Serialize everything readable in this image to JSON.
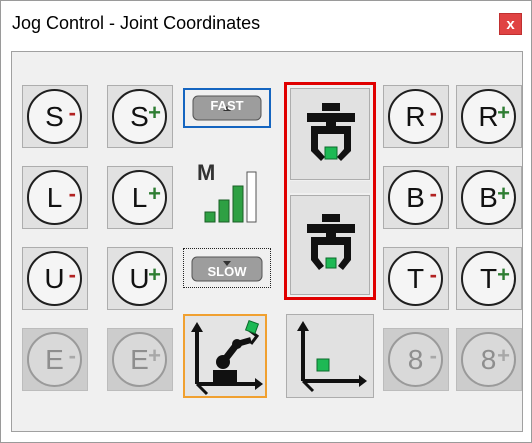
{
  "window": {
    "title": "Jog Control - Joint Coordinates",
    "close_label": "x"
  },
  "joints": {
    "s_minus": {
      "letter": "S",
      "sign": "-"
    },
    "s_plus": {
      "letter": "S",
      "sign": "+"
    },
    "l_minus": {
      "letter": "L",
      "sign": "-"
    },
    "l_plus": {
      "letter": "L",
      "sign": "+"
    },
    "u_minus": {
      "letter": "U",
      "sign": "-"
    },
    "u_plus": {
      "letter": "U",
      "sign": "+"
    },
    "e_minus": {
      "letter": "E",
      "sign": "-"
    },
    "e_plus": {
      "letter": "E",
      "sign": "+"
    },
    "r_minus": {
      "letter": "R",
      "sign": "-"
    },
    "r_plus": {
      "letter": "R",
      "sign": "+"
    },
    "b_minus": {
      "letter": "B",
      "sign": "-"
    },
    "b_plus": {
      "letter": "B",
      "sign": "+"
    },
    "t_minus": {
      "letter": "T",
      "sign": "-"
    },
    "t_plus": {
      "letter": "T",
      "sign": "+"
    },
    "axis8_minus": {
      "letter": "8",
      "sign": "-"
    },
    "axis8_plus": {
      "letter": "8",
      "sign": "+"
    }
  },
  "speed": {
    "fast_label": "FAST",
    "slow_label": "SLOW",
    "level_label": "M",
    "level_bars_filled": 3,
    "level_bars_total": 4
  },
  "colors": {
    "minus_sign": "#b22222",
    "plus_sign": "#2e7d32",
    "selected_speed": "#1565c0",
    "tool_selection": "#e00000",
    "coord_selection": "#f0a030",
    "green_block": "#1db954"
  },
  "icons": {
    "tool_open": "gripper-open-icon",
    "tool_closed": "gripper-closed-icon",
    "joint_coords": "robot-joint-coordinates-icon",
    "world_coords": "world-coordinates-icon"
  }
}
